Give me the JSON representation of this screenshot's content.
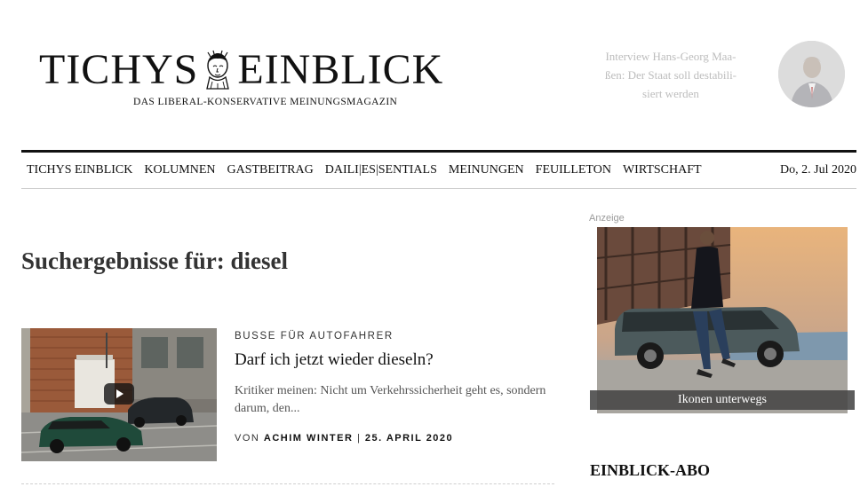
{
  "header": {
    "logo_left": "TICHYS",
    "logo_right": "EINBLICK",
    "tagline": "DAS LIBERAL-KONSERVATIVE MEINUNGSMAGAZIN",
    "teaser": {
      "line1": "Interview Hans-Georg Maa-",
      "line2": "ßen: Der Staat soll destabili-",
      "line3": "siert werden"
    }
  },
  "nav": {
    "items": [
      "TICHYS EINBLICK",
      "KOLUMNEN",
      "GASTBEITRAG",
      "DAILI|ES|SENTIALS",
      "MEINUNGEN",
      "FEUILLETON",
      "WIRTSCHAFT"
    ],
    "date": "Do, 2. Jul 2020"
  },
  "main": {
    "search_title": "Suchergebnisse für: diesel",
    "article": {
      "kicker": "BUSSE FÜR AUTOFAHRER",
      "headline": "Darf ich jetzt wieder dieseln?",
      "excerpt": "Kritiker meinen: Nicht um Verkehrssicherheit geht es, sondern darum, den...",
      "byline_prefix": "VON",
      "author": "ACHIM WINTER",
      "separator": "|",
      "date": "25. APRIL 2020",
      "thumbnail_icon": "play-icon"
    }
  },
  "sidebar": {
    "ad_label": "Anzeige",
    "ad_caption": "Ikonen unterwegs",
    "abo_title": "EINBLICK-ABO"
  },
  "colors": {
    "text": "#222222",
    "teaser": "#bdbdbd",
    "rule": "#111111"
  }
}
